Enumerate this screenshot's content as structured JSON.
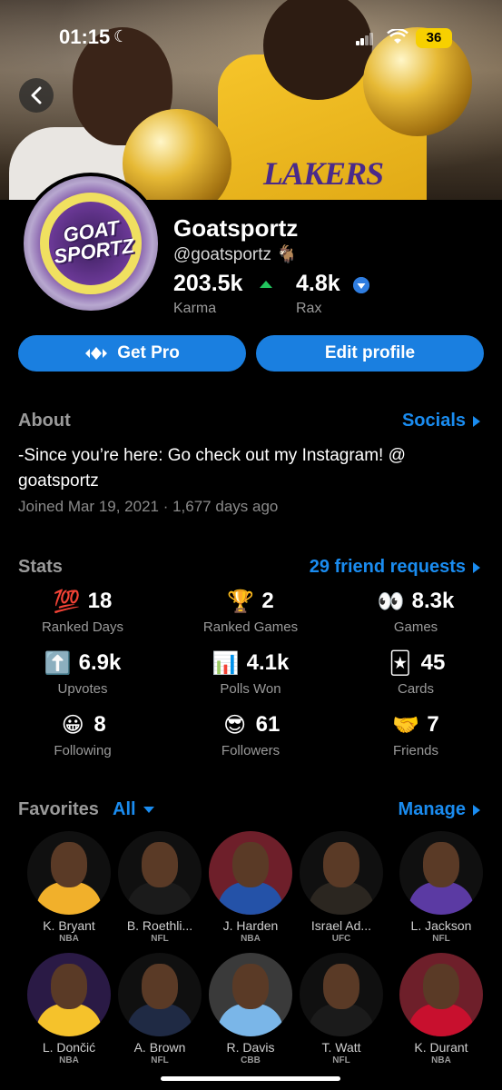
{
  "status_bar": {
    "time": "01:15",
    "battery": "36"
  },
  "profile": {
    "name": "Goatsportz",
    "handle": "@goatsportz 🐐",
    "karma_value": "203.5k",
    "karma_label": "Karma",
    "rax_value": "4.8k",
    "rax_label": "Rax",
    "avatar_text": "GOAT SPORTZ"
  },
  "banner": {
    "jersey_text": "LAKERS"
  },
  "buttons": {
    "get_pro": "Get Pro",
    "edit_profile": "Edit profile"
  },
  "about": {
    "title": "About",
    "socials_link": "Socials",
    "bio": "-Since you’re here: Go check out my Instagram! @ goatsportz",
    "joined": "Joined Mar 19, 2021 · 1,677 days ago"
  },
  "stats": {
    "title": "Stats",
    "friend_requests": "29 friend requests",
    "items": [
      {
        "icon": "💯",
        "value": "18",
        "label": "Ranked Days"
      },
      {
        "icon": "🏆",
        "value": "2",
        "label": "Ranked Games"
      },
      {
        "icon": "👀",
        "value": "8.3k",
        "label": "Games"
      },
      {
        "icon": "⬆️",
        "value": "6.9k",
        "label": "Upvotes"
      },
      {
        "icon": "📊",
        "value": "4.1k",
        "label": "Polls Won"
      },
      {
        "icon": "🃏",
        "value": "45",
        "label": "Cards"
      },
      {
        "icon": "😀",
        "value": "8",
        "label": "Following"
      },
      {
        "icon": "😎",
        "value": "61",
        "label": "Followers"
      },
      {
        "icon": "🤝",
        "value": "7",
        "label": "Friends"
      }
    ]
  },
  "favorites": {
    "title": "Favorites",
    "filter": "All",
    "manage": "Manage",
    "players": [
      {
        "name": "K. Bryant",
        "league": "NBA",
        "bg": "#101010",
        "body": "#f1b02b"
      },
      {
        "name": "B. Roethli...",
        "league": "NFL",
        "bg": "#101010",
        "body": "#1b1b1b"
      },
      {
        "name": "J. Harden",
        "league": "NBA",
        "bg": "#6e1f2a",
        "body": "#2452a8"
      },
      {
        "name": "Israel Ad...",
        "league": "UFC",
        "bg": "#101010",
        "body": "#2b2620"
      },
      {
        "name": "L. Jackson",
        "league": "NFL",
        "bg": "#101010",
        "body": "#5b3aa3"
      },
      {
        "name": "L. Dončić",
        "league": "NBA",
        "bg": "#2a1a45",
        "body": "#f5c22b"
      },
      {
        "name": "A. Brown",
        "league": "NFL",
        "bg": "#101010",
        "body": "#1f2a44"
      },
      {
        "name": "R. Davis",
        "league": "CBB",
        "bg": "#3a3a3a",
        "body": "#7ab6e8"
      },
      {
        "name": "T. Watt",
        "league": "NFL",
        "bg": "#101010",
        "body": "#1b1b1b"
      },
      {
        "name": "K. Durant",
        "league": "NBA",
        "bg": "#6e1f2a",
        "body": "#c8102e"
      }
    ]
  }
}
